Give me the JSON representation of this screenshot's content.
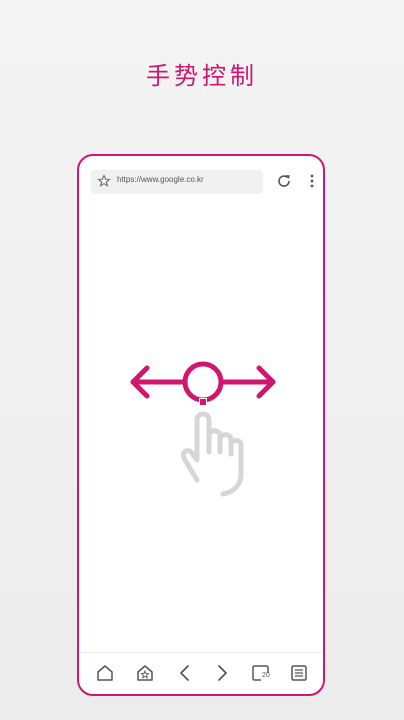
{
  "headline": "手势控制",
  "browser": {
    "url": "https://www.google.co.kr",
    "tab_count": "20"
  },
  "colors": {
    "accent": "#d0166f",
    "frame_background": "#ffffff",
    "page_background": "#f0f0f0"
  },
  "icons": {
    "toolbar": [
      "star-icon",
      "refresh-icon",
      "more-vert-icon"
    ],
    "bottom_nav": [
      "home-icon",
      "bookmarks-home-icon",
      "back-icon",
      "forward-icon",
      "tabs-icon",
      "menu-list-icon"
    ],
    "illustration": [
      "swipe-gesture-icon",
      "hand-pointer-icon"
    ]
  }
}
